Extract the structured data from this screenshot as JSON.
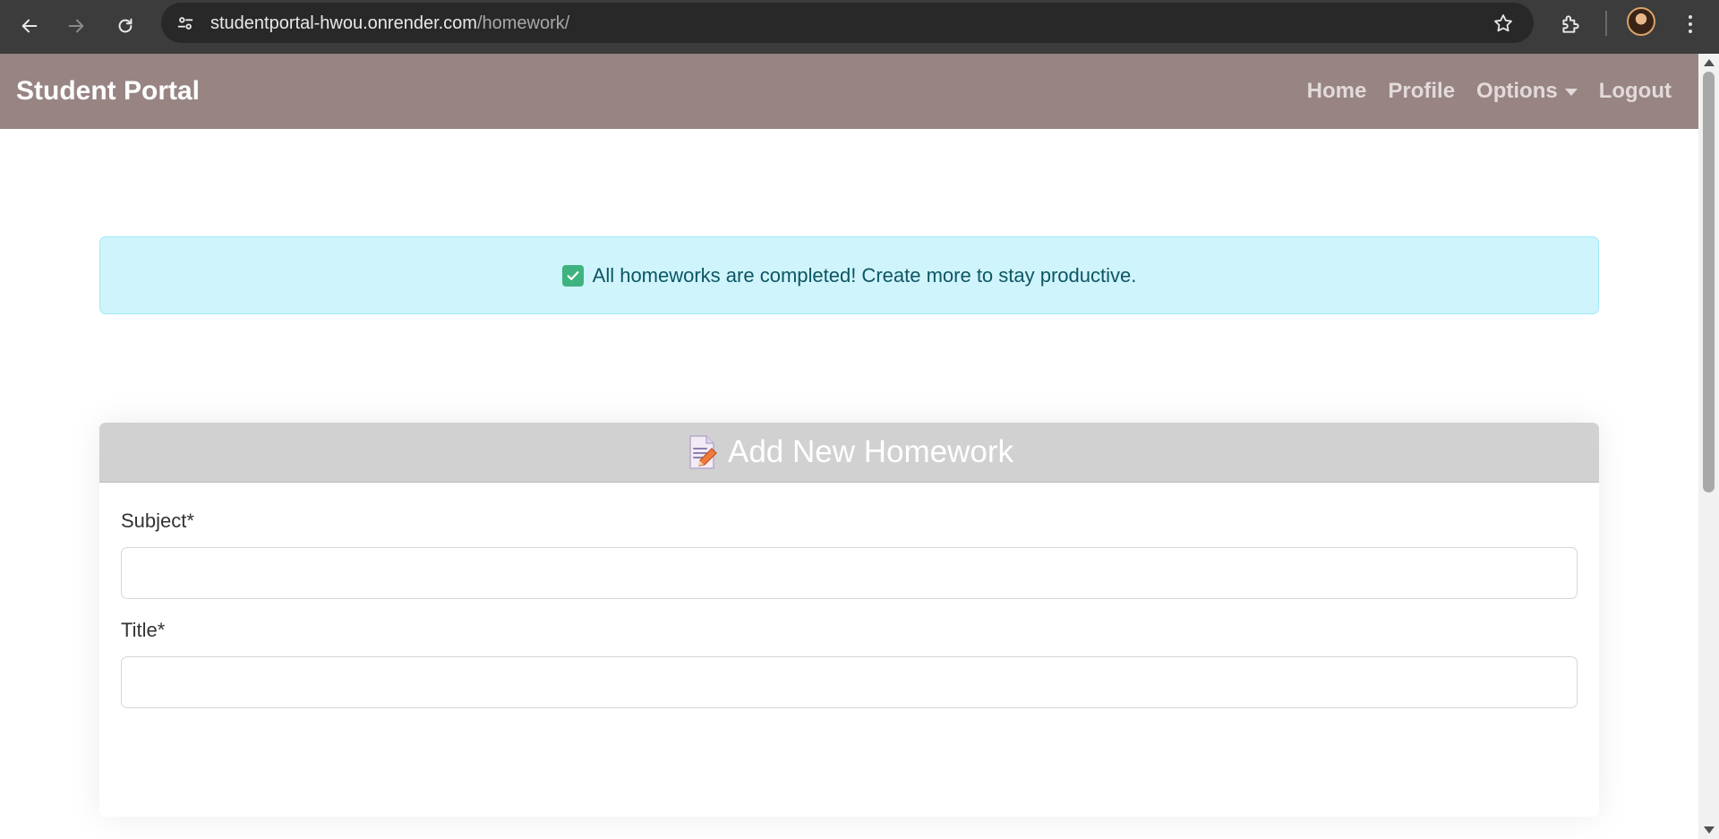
{
  "browser": {
    "url_domain": "studentportal-hwou.onrender.com",
    "url_path": "/homework/",
    "icons": [
      "back-arrow-icon",
      "forward-arrow-icon",
      "reload-icon",
      "site-info-icon",
      "bookmark-star-icon",
      "extensions-icon",
      "profile-avatar",
      "kebab-menu-icon"
    ]
  },
  "navbar": {
    "brand": "Student Portal",
    "links": {
      "home": "Home",
      "profile": "Profile",
      "options": "Options",
      "logout": "Logout"
    },
    "background_color": "#978483"
  },
  "alert": {
    "icon": "check-mark-icon",
    "message": "All homeworks are completed! Create more to stay productive.",
    "background_color": "#cff4fb"
  },
  "form": {
    "icon": "memo-icon",
    "title": "Add New Homework",
    "fields": [
      {
        "label": "Subject*",
        "value": ""
      },
      {
        "label": "Title*",
        "value": ""
      }
    ]
  }
}
